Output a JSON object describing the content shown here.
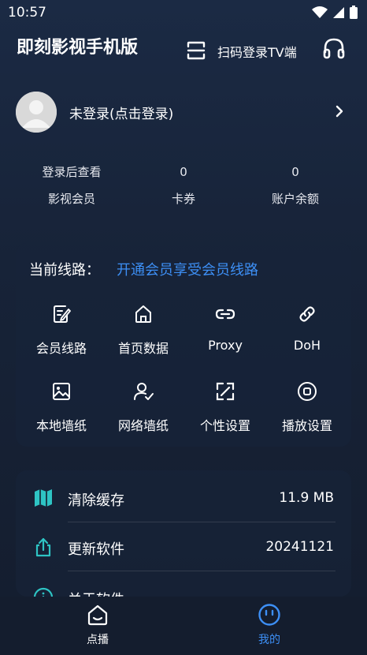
{
  "status_bar": {
    "time": "10:57"
  },
  "header": {
    "title": "即刻影视手机版",
    "scan_label": "扫码登录TV端"
  },
  "profile": {
    "login_text": "未登录(点击登录)"
  },
  "stats": [
    {
      "value": "登录后查看",
      "label": "影视会员"
    },
    {
      "value": "0",
      "label": "卡券"
    },
    {
      "value": "0",
      "label": "账户余额"
    }
  ],
  "route": {
    "label": "当前线路：",
    "link": "开通会员享受会员线路"
  },
  "grid": [
    {
      "label": "会员线路",
      "icon": "edit-doc-icon"
    },
    {
      "label": "首页数据",
      "icon": "home-icon"
    },
    {
      "label": "Proxy",
      "icon": "link-icon"
    },
    {
      "label": "DoH",
      "icon": "chain-icon"
    },
    {
      "label": "本地墙纸",
      "icon": "image-icon"
    },
    {
      "label": "网络墙纸",
      "icon": "user-check-icon"
    },
    {
      "label": "个性设置",
      "icon": "expand-icon"
    },
    {
      "label": "播放设置",
      "icon": "record-icon"
    }
  ],
  "list": [
    {
      "label": "清除缓存",
      "value": "11.9 MB",
      "icon": "map-icon"
    },
    {
      "label": "更新软件",
      "value": "20241121",
      "icon": "share-upload-icon"
    },
    {
      "label": "关于软件",
      "value": "",
      "icon": "info-icon"
    }
  ],
  "nav": [
    {
      "label": "点播",
      "icon": "home-smile-icon",
      "active": false
    },
    {
      "label": "我的",
      "icon": "face-icon",
      "active": true
    }
  ],
  "colors": {
    "accent_link": "#3d8ff5",
    "accent_teal": "#2ec4c4",
    "active_nav": "#3d8ff5"
  }
}
